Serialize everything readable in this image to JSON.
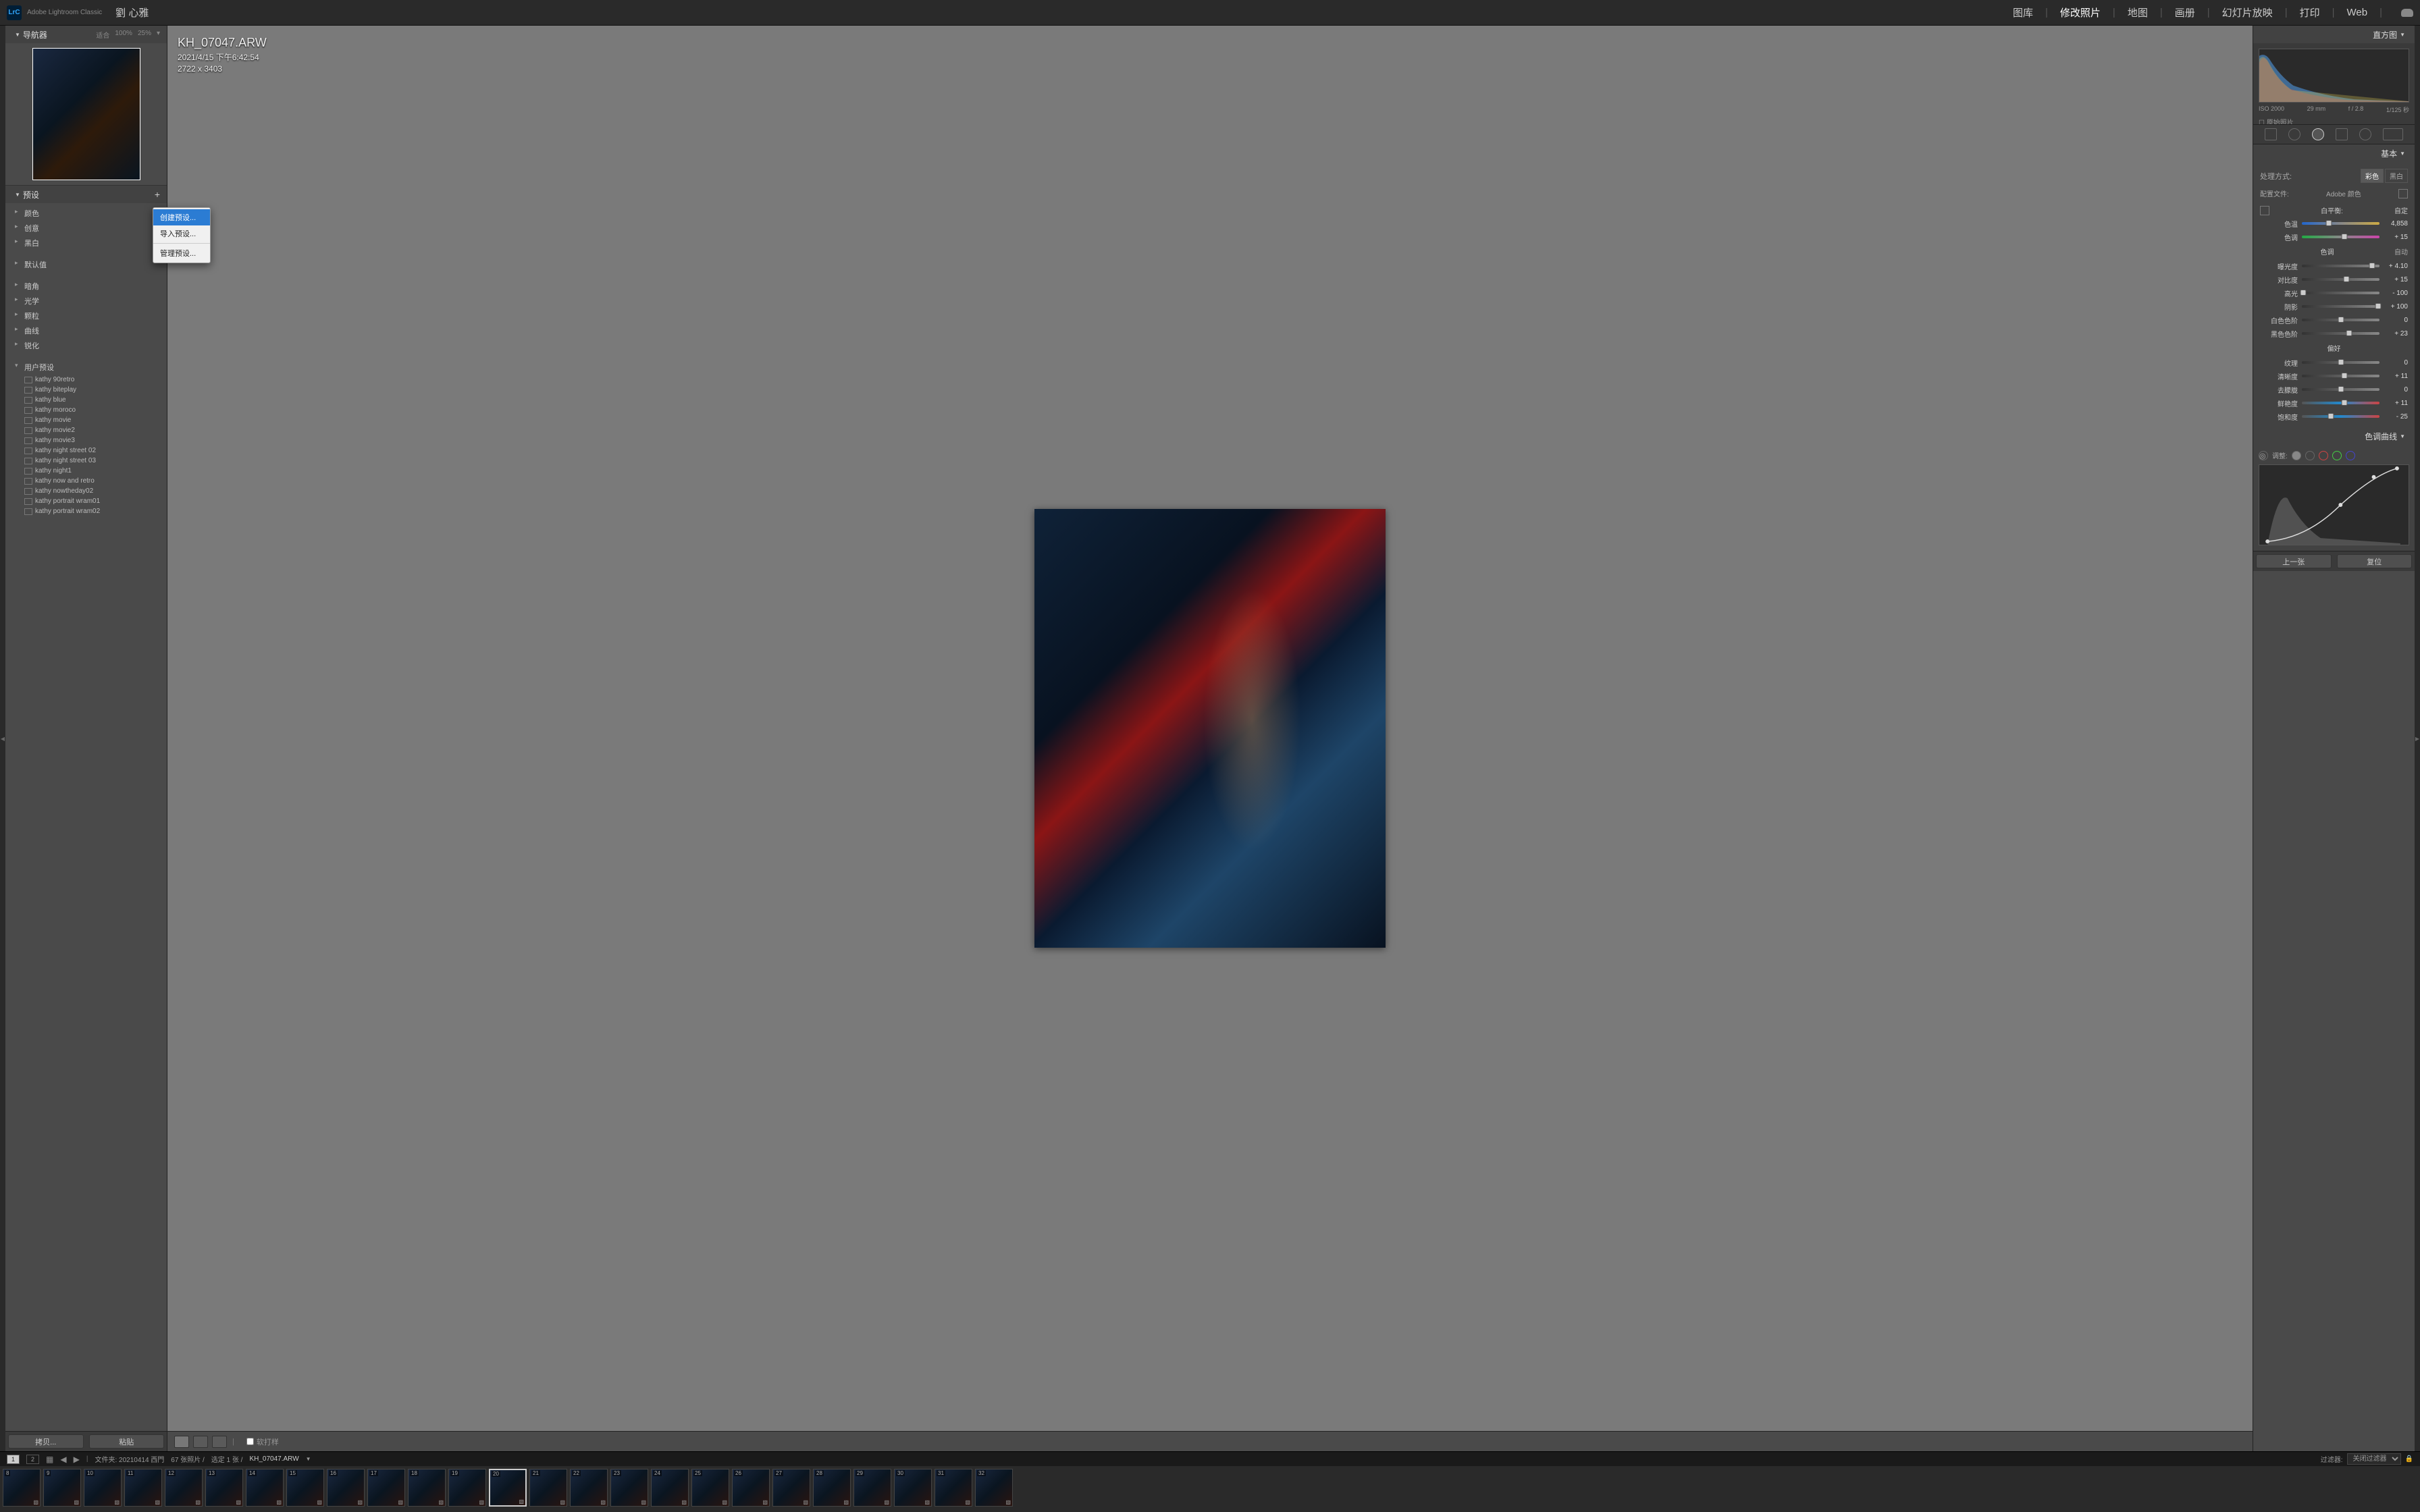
{
  "app_name": "Adobe Lightroom Classic",
  "logo_text": "LrC",
  "user_name": "劉 心雅",
  "modules": {
    "library": "图库",
    "develop": "修改照片",
    "map": "地图",
    "book": "画册",
    "slideshow": "幻灯片放映",
    "print": "打印",
    "web": "Web"
  },
  "left": {
    "navigator": "导航器",
    "nav_opts": {
      "fit": "适合",
      "p100": "100%",
      "p25": "25%"
    },
    "presets_title": "预设",
    "groups": {
      "color": "颜色",
      "creative": "创意",
      "bw": "黑白",
      "defaults": "默认值",
      "vignette": "暗角",
      "optics": "光学",
      "grain": "颗粒",
      "curves": "曲线",
      "sharpen": "锐化",
      "user": "用户预设"
    },
    "user_presets": [
      "kathy 90retro",
      "kathy biteplay",
      "kathy blue",
      "kathy moroco",
      "kathy movie",
      "kathy movie2",
      "kathy movie3",
      "kathy night street 02",
      "kathy night street 03",
      "kathy night1",
      "kathy now and retro",
      "kathy nowtheday02",
      "kathy portrait wram01",
      "kathy portrait wram02"
    ],
    "btn_copy": "拷贝...",
    "btn_paste": "粘贴"
  },
  "context_menu": {
    "create": "创建预设...",
    "import": "导入预设...",
    "manage": "管理预设..."
  },
  "center": {
    "filename": "KH_07047.ARW",
    "datetime": "2021/4/15 下午6:42:54",
    "dimensions": "2722 x 3403",
    "soft_proof": "软打样"
  },
  "right": {
    "histogram_title": "直方图",
    "iso": "ISO 2000",
    "focal": "29 mm",
    "aperture": "f / 2.8",
    "shutter": "1/125 秒",
    "original": "原始照片",
    "basic_title": "基本",
    "treatment_label": "处理方式:",
    "treatment_color": "彩色",
    "treatment_bw": "黑白",
    "profile_label": "配置文件:",
    "profile_value": "Adobe 颜色",
    "wb_label": "白平衡:",
    "wb_value": "自定",
    "temp": "色温",
    "temp_val": "4,858",
    "tint": "色调",
    "tint_val": "+ 15",
    "tone_section": "色调",
    "tone_auto": "自动",
    "exposure": "曝光度",
    "exposure_val": "+ 4.10",
    "contrast": "对比度",
    "contrast_val": "+ 15",
    "highlights": "高光",
    "highlights_val": "- 100",
    "shadows": "阴影",
    "shadows_val": "+ 100",
    "whites": "白色色阶",
    "whites_val": "0",
    "blacks": "黑色色阶",
    "blacks_val": "+ 23",
    "presence_section": "偏好",
    "texture": "纹理",
    "texture_val": "0",
    "clarity": "清晰度",
    "clarity_val": "+ 11",
    "dehaze": "去朦胧",
    "dehaze_val": "0",
    "vibrance": "鲜艳度",
    "vibrance_val": "+ 11",
    "saturation": "饱和度",
    "saturation_val": "- 25",
    "curve_title": "色调曲线",
    "curve_adjust": "调整:",
    "btn_prev": "上一张",
    "btn_reset": "复位"
  },
  "status": {
    "page1": "1",
    "page2": "2",
    "folder_label": "文件夹: ",
    "folder": "20210414 西門",
    "count": "67 张照片 /",
    "selected": "选定 1 张 /",
    "current": "KH_07047.ARW",
    "filter_label": "过滤器:",
    "filter_value": "关闭过滤器"
  },
  "filmstrip_start": 8,
  "filmstrip_count": 25,
  "filmstrip_selected": 20
}
